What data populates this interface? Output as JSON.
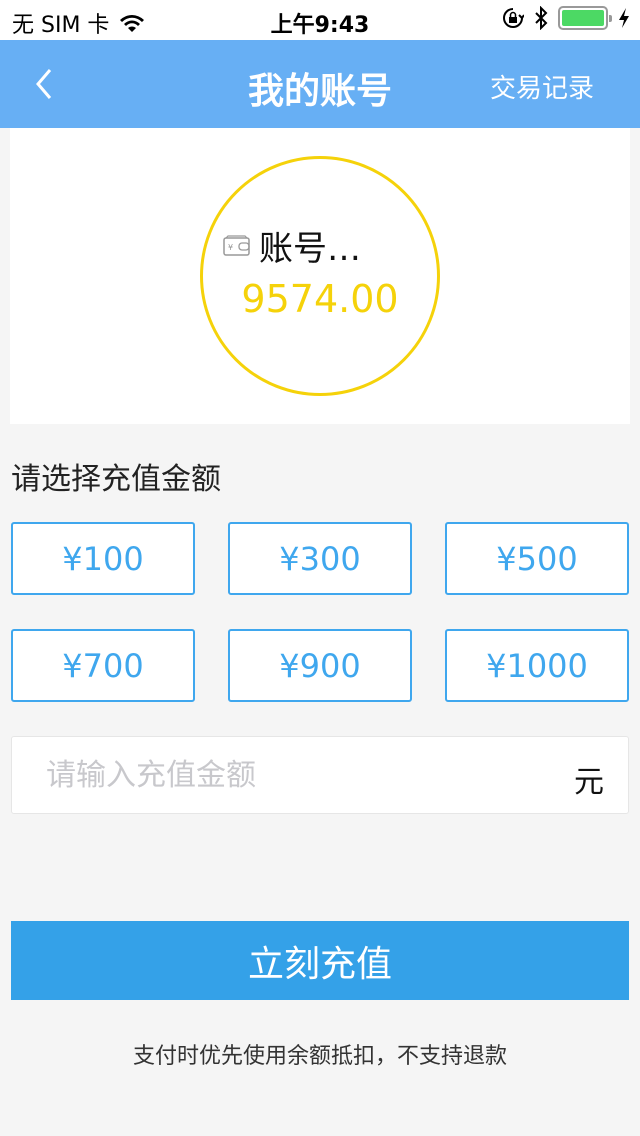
{
  "status_bar": {
    "carrier": "无 SIM 卡",
    "time": "上午9:43",
    "icons": [
      "wifi-icon",
      "orientation-lock-icon",
      "bluetooth-icon",
      "battery-icon",
      "charging-icon"
    ],
    "battery_level": 1.0
  },
  "nav": {
    "back_icon": "chevron-left-icon",
    "title": "我的账号",
    "right_action": "交易记录"
  },
  "balance": {
    "icon": "wallet-icon",
    "account_label": "账号…",
    "value": "9574.00"
  },
  "recharge": {
    "section_label": "请选择充值金额",
    "amounts": [
      {
        "label": "¥100"
      },
      {
        "label": "¥300"
      },
      {
        "label": "¥500"
      },
      {
        "label": "¥700"
      },
      {
        "label": "¥900"
      },
      {
        "label": "¥1000"
      }
    ],
    "input_placeholder": "请输入充值金额",
    "input_value": "",
    "unit": "元",
    "submit_label": "立刻充值",
    "note": "支付时优先使用余额抵扣，不支持退款"
  },
  "colors": {
    "nav_bg": "#67aff4",
    "accent_blue": "#3fa7ee",
    "submit_bg": "#34a1e8",
    "balance_yellow": "#f5d20a",
    "page_bg": "#f5f5f5"
  }
}
